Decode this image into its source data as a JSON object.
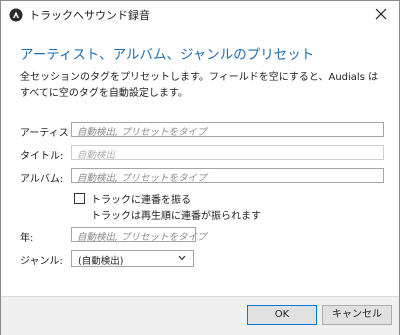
{
  "window": {
    "title": "トラックへサウンド録音"
  },
  "heading": "アーティスト、アルバム、ジャンルのプリセット",
  "description": "全セッションのタグをプリセットします。フィールドを空にすると、Audials はすべてに空のタグを自動設定します。",
  "fields": {
    "artist": {
      "label": "アーティスト:",
      "placeholder": "自動検出, プリセットをタイプ"
    },
    "title": {
      "label": "タイトル:",
      "placeholder": "自動検出"
    },
    "album": {
      "label": "アルバム:",
      "placeholder": "自動検出, プリセットをタイプ"
    },
    "year": {
      "label": "年:",
      "placeholder": "自動検出, プリセットをタイプ"
    },
    "genre": {
      "label": "ジャンル:",
      "value": "(自動検出)"
    }
  },
  "numbering": {
    "label": "トラックに連番を振る",
    "sublabel": "トラックは再生順に連番が振られます",
    "checked": false
  },
  "buttons": {
    "ok": "OK",
    "cancel": "キャンセル"
  },
  "icons": {
    "app": "app-logo-icon",
    "close": "close-icon",
    "dropdown": "chevron-down-icon"
  },
  "colors": {
    "heading": "#1f6fb4",
    "ok_border": "#0078d7"
  }
}
